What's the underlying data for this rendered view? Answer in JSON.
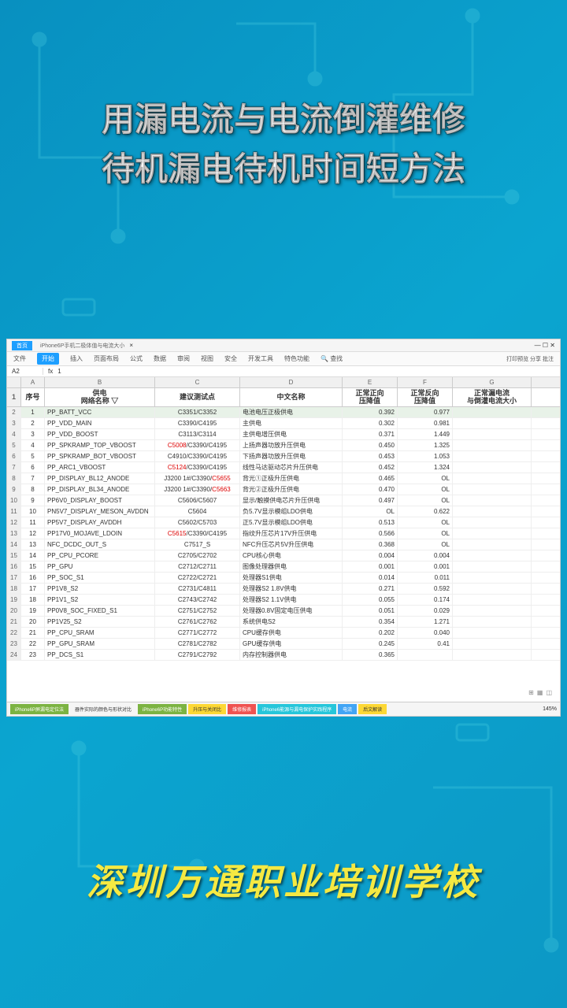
{
  "title": {
    "line1": "用漏电流与电流倒灌维修",
    "line2": "待机漏电待机时间短方法"
  },
  "school": "深圳万通职业培训学校",
  "window": {
    "tabs": [
      "首页",
      "iPhone6P手机二极体值与电流大小"
    ],
    "ribbon": [
      "文件",
      "开始",
      "插入",
      "页面布局",
      "公式",
      "数据",
      "审阅",
      "视图",
      "安全",
      "开发工具",
      "特色功能",
      "查找"
    ],
    "right_actions": "打印预览 分享 批注",
    "cell_ref": "A2",
    "cell_value": "1"
  },
  "columns": [
    "A",
    "B",
    "C",
    "D",
    "E",
    "F",
    "G"
  ],
  "headers": {
    "a": "序号",
    "b": "供电\n网络名称",
    "c": "建议测试点",
    "d": "中文名称",
    "e": "正常正向\n压降值",
    "f": "正常反向\n压降值",
    "g": "正常漏电流\n与倒灌电流大小"
  },
  "rows": [
    {
      "n": "1",
      "b": "PP_BATT_VCC",
      "c": "C3351/C3352",
      "d": "电池电压正极供电",
      "e": "0.392",
      "f": "0.977"
    },
    {
      "n": "2",
      "b": "PP_VDD_MAIN",
      "c": "C3390/C4195",
      "d": "主供电",
      "e": "0.302",
      "f": "0.981"
    },
    {
      "n": "3",
      "b": "PP_VDD_BOOST",
      "c": "C3113/C3114",
      "d": "主供电增压供电",
      "e": "0.371",
      "f": "1.449"
    },
    {
      "n": "4",
      "b": "PP_SPKRAMP_TOP_VBOOST",
      "c": "C5008/C3390/C4195",
      "cred": true,
      "d": "上扬声器功放升压供电",
      "e": "0.450",
      "f": "1.325"
    },
    {
      "n": "5",
      "b": "PP_SPKRAMP_BOT_VBOOST",
      "c": "C4910/C3390/C4195",
      "d": "下扬声器功放升压供电",
      "e": "0.453",
      "f": "1.053"
    },
    {
      "n": "6",
      "b": "PP_ARC1_VBOOST",
      "c": "C5124/C3390/C4195",
      "cred": true,
      "d": "线性马达驱动芯片升压供电",
      "e": "0.452",
      "f": "1.324"
    },
    {
      "n": "7",
      "b": "PP_DISPLAY_BL12_ANODE",
      "c": "J3200 1#/C3390/C5655",
      "cred2": true,
      "d": "背光①正极升压供电",
      "e": "0.465",
      "f": "OL"
    },
    {
      "n": "8",
      "b": "PP_DISPLAY_BL34_ANODE",
      "c": "J3200 1#/C3390/C5663",
      "cred2": true,
      "d": "背光②正极升压供电",
      "e": "0.470",
      "f": "OL"
    },
    {
      "n": "9",
      "b": "PP6V0_DISPLAY_BOOST",
      "c": "C5606/C5607",
      "d": "显示/触摸供电芯片升压供电",
      "e": "0.497",
      "f": "OL"
    },
    {
      "n": "10",
      "b": "PN5V7_DISPLAY_MESON_AVDDN",
      "c": "C5604",
      "d": "负5.7V显示模组LDO供电",
      "e": "OL",
      "f": "0.622"
    },
    {
      "n": "11",
      "b": "PP5V7_DISPLAY_AVDDH",
      "c": "C5602/C5703",
      "d": "正5.7V显示模组LDO供电",
      "e": "0.513",
      "f": "OL"
    },
    {
      "n": "12",
      "b": "PP17V0_MOJAVE_LDOIN",
      "c": "C5615/C3390/C4195",
      "cred": true,
      "d": "指纹升压芯片17V升压供电",
      "e": "0.566",
      "f": "OL"
    },
    {
      "n": "13",
      "b": "NFC_DCDC_OUT_S",
      "c": "C7517_S",
      "d": "NFC升压芯片5V升压供电",
      "e": "0.368",
      "f": "OL"
    },
    {
      "n": "14",
      "b": "PP_CPU_PCORE",
      "c": "C2705/C2702",
      "d": "CPU核心供电",
      "e": "0.004",
      "f": "0.004"
    },
    {
      "n": "15",
      "b": "PP_GPU",
      "c": "C2712/C2711",
      "d": "图像处理器供电",
      "e": "0.001",
      "f": "0.001"
    },
    {
      "n": "16",
      "b": "PP_SOC_S1",
      "c": "C2722/C2721",
      "d": "处理器S1供电",
      "e": "0.014",
      "f": "0.011"
    },
    {
      "n": "17",
      "b": "PP1V8_S2",
      "c": "C2731/C4811",
      "d": "处理器S2 1.8V供电",
      "e": "0.271",
      "f": "0.592"
    },
    {
      "n": "18",
      "b": "PP1V1_S2",
      "c": "C2743/C2742",
      "d": "处理器S2 1.1V供电",
      "e": "0.055",
      "f": "0.174"
    },
    {
      "n": "19",
      "b": "PP0V8_SOC_FIXED_S1",
      "c": "C2751/C2752",
      "d": "处理器0.8V固定电压供电",
      "e": "0.051",
      "f": "0.029"
    },
    {
      "n": "20",
      "b": "PP1V25_S2",
      "c": "C2761/C2762",
      "d": "系统供电S2",
      "e": "0.354",
      "f": "1.271"
    },
    {
      "n": "21",
      "b": "PP_CPU_SRAM",
      "c": "C2771/C2772",
      "d": "CPU缓存供电",
      "e": "0.202",
      "f": "0.040"
    },
    {
      "n": "22",
      "b": "PP_GPU_SRAM",
      "c": "C2781/C2782",
      "d": "GPU缓存供电",
      "e": "0.245",
      "f": "0.41"
    },
    {
      "n": "23",
      "b": "PP_DCS_S1",
      "c": "C2791/C2792",
      "d": "内存控制器供电",
      "e": "0.365",
      "f": ""
    }
  ],
  "sheet_tabs": [
    "iPhone6P屏漏电定位法",
    "器件实际的颜色与形状对比",
    "iPhone6P功能特性",
    "升压与关闭比",
    "维修报表",
    "iPhone6能源与漏电保护实践程序",
    "电流",
    "后文解读"
  ],
  "zoom": "145%"
}
